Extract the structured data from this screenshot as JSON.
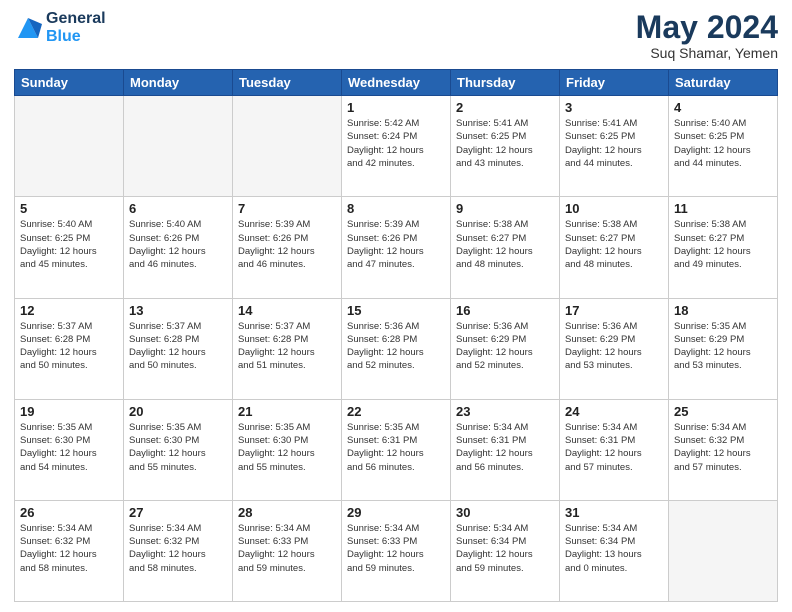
{
  "header": {
    "logo_line1": "General",
    "logo_line2": "Blue",
    "month_title": "May 2024",
    "subtitle": "Suq Shamar, Yemen"
  },
  "weekdays": [
    "Sunday",
    "Monday",
    "Tuesday",
    "Wednesday",
    "Thursday",
    "Friday",
    "Saturday"
  ],
  "weeks": [
    [
      {
        "day": "",
        "info": ""
      },
      {
        "day": "",
        "info": ""
      },
      {
        "day": "",
        "info": ""
      },
      {
        "day": "1",
        "info": "Sunrise: 5:42 AM\nSunset: 6:24 PM\nDaylight: 12 hours\nand 42 minutes."
      },
      {
        "day": "2",
        "info": "Sunrise: 5:41 AM\nSunset: 6:25 PM\nDaylight: 12 hours\nand 43 minutes."
      },
      {
        "day": "3",
        "info": "Sunrise: 5:41 AM\nSunset: 6:25 PM\nDaylight: 12 hours\nand 44 minutes."
      },
      {
        "day": "4",
        "info": "Sunrise: 5:40 AM\nSunset: 6:25 PM\nDaylight: 12 hours\nand 44 minutes."
      }
    ],
    [
      {
        "day": "5",
        "info": "Sunrise: 5:40 AM\nSunset: 6:25 PM\nDaylight: 12 hours\nand 45 minutes."
      },
      {
        "day": "6",
        "info": "Sunrise: 5:40 AM\nSunset: 6:26 PM\nDaylight: 12 hours\nand 46 minutes."
      },
      {
        "day": "7",
        "info": "Sunrise: 5:39 AM\nSunset: 6:26 PM\nDaylight: 12 hours\nand 46 minutes."
      },
      {
        "day": "8",
        "info": "Sunrise: 5:39 AM\nSunset: 6:26 PM\nDaylight: 12 hours\nand 47 minutes."
      },
      {
        "day": "9",
        "info": "Sunrise: 5:38 AM\nSunset: 6:27 PM\nDaylight: 12 hours\nand 48 minutes."
      },
      {
        "day": "10",
        "info": "Sunrise: 5:38 AM\nSunset: 6:27 PM\nDaylight: 12 hours\nand 48 minutes."
      },
      {
        "day": "11",
        "info": "Sunrise: 5:38 AM\nSunset: 6:27 PM\nDaylight: 12 hours\nand 49 minutes."
      }
    ],
    [
      {
        "day": "12",
        "info": "Sunrise: 5:37 AM\nSunset: 6:28 PM\nDaylight: 12 hours\nand 50 minutes."
      },
      {
        "day": "13",
        "info": "Sunrise: 5:37 AM\nSunset: 6:28 PM\nDaylight: 12 hours\nand 50 minutes."
      },
      {
        "day": "14",
        "info": "Sunrise: 5:37 AM\nSunset: 6:28 PM\nDaylight: 12 hours\nand 51 minutes."
      },
      {
        "day": "15",
        "info": "Sunrise: 5:36 AM\nSunset: 6:28 PM\nDaylight: 12 hours\nand 52 minutes."
      },
      {
        "day": "16",
        "info": "Sunrise: 5:36 AM\nSunset: 6:29 PM\nDaylight: 12 hours\nand 52 minutes."
      },
      {
        "day": "17",
        "info": "Sunrise: 5:36 AM\nSunset: 6:29 PM\nDaylight: 12 hours\nand 53 minutes."
      },
      {
        "day": "18",
        "info": "Sunrise: 5:35 AM\nSunset: 6:29 PM\nDaylight: 12 hours\nand 53 minutes."
      }
    ],
    [
      {
        "day": "19",
        "info": "Sunrise: 5:35 AM\nSunset: 6:30 PM\nDaylight: 12 hours\nand 54 minutes."
      },
      {
        "day": "20",
        "info": "Sunrise: 5:35 AM\nSunset: 6:30 PM\nDaylight: 12 hours\nand 55 minutes."
      },
      {
        "day": "21",
        "info": "Sunrise: 5:35 AM\nSunset: 6:30 PM\nDaylight: 12 hours\nand 55 minutes."
      },
      {
        "day": "22",
        "info": "Sunrise: 5:35 AM\nSunset: 6:31 PM\nDaylight: 12 hours\nand 56 minutes."
      },
      {
        "day": "23",
        "info": "Sunrise: 5:34 AM\nSunset: 6:31 PM\nDaylight: 12 hours\nand 56 minutes."
      },
      {
        "day": "24",
        "info": "Sunrise: 5:34 AM\nSunset: 6:31 PM\nDaylight: 12 hours\nand 57 minutes."
      },
      {
        "day": "25",
        "info": "Sunrise: 5:34 AM\nSunset: 6:32 PM\nDaylight: 12 hours\nand 57 minutes."
      }
    ],
    [
      {
        "day": "26",
        "info": "Sunrise: 5:34 AM\nSunset: 6:32 PM\nDaylight: 12 hours\nand 58 minutes."
      },
      {
        "day": "27",
        "info": "Sunrise: 5:34 AM\nSunset: 6:32 PM\nDaylight: 12 hours\nand 58 minutes."
      },
      {
        "day": "28",
        "info": "Sunrise: 5:34 AM\nSunset: 6:33 PM\nDaylight: 12 hours\nand 59 minutes."
      },
      {
        "day": "29",
        "info": "Sunrise: 5:34 AM\nSunset: 6:33 PM\nDaylight: 12 hours\nand 59 minutes."
      },
      {
        "day": "30",
        "info": "Sunrise: 5:34 AM\nSunset: 6:34 PM\nDaylight: 12 hours\nand 59 minutes."
      },
      {
        "day": "31",
        "info": "Sunrise: 5:34 AM\nSunset: 6:34 PM\nDaylight: 13 hours\nand 0 minutes."
      },
      {
        "day": "",
        "info": ""
      }
    ]
  ]
}
